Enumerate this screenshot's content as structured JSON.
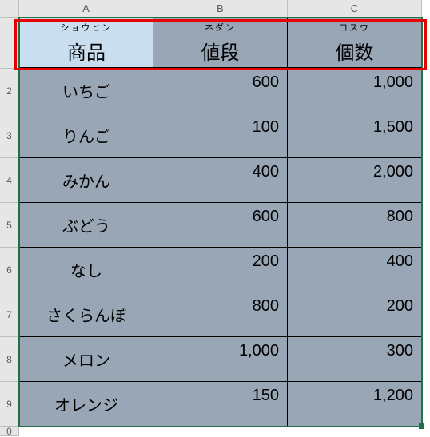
{
  "columns": {
    "A": "A",
    "B": "B",
    "C": "C"
  },
  "rownums": {
    "r2": "2",
    "r3": "3",
    "r4": "4",
    "r5": "5",
    "r6": "6",
    "r7": "7",
    "r8": "8",
    "r9": "9",
    "r10": "0"
  },
  "header": {
    "product": {
      "ruby": "ショウヒン",
      "label": "商品"
    },
    "price": {
      "ruby": "ネダン",
      "label": "値段"
    },
    "qty": {
      "ruby": "コスウ",
      "label": "個数"
    }
  },
  "rows": {
    "0": {
      "product": "いちご",
      "price": "600",
      "qty": "1,000"
    },
    "1": {
      "product": "りんご",
      "price": "100",
      "qty": "1,500"
    },
    "2": {
      "product": "みかん",
      "price": "400",
      "qty": "2,000"
    },
    "3": {
      "product": "ぶどう",
      "price": "600",
      "qty": "800"
    },
    "4": {
      "product": "なし",
      "price": "200",
      "qty": "400"
    },
    "5": {
      "product": "さくらんぼ",
      "price": "800",
      "qty": "200"
    },
    "6": {
      "product": "メロン",
      "price": "1,000",
      "qty": "300"
    },
    "7": {
      "product": "オレンジ",
      "price": "150",
      "qty": "1,200"
    }
  },
  "chart_data": {
    "type": "table",
    "title": "",
    "columns": [
      "商品",
      "値段",
      "個数"
    ],
    "column_ruby": [
      "ショウヒン",
      "ネダン",
      "コスウ"
    ],
    "records": [
      {
        "商品": "いちご",
        "値段": 600,
        "個数": 1000
      },
      {
        "商品": "りんご",
        "値段": 100,
        "個数": 1500
      },
      {
        "商品": "みかん",
        "値段": 400,
        "個数": 2000
      },
      {
        "商品": "ぶどう",
        "値段": 600,
        "個数": 800
      },
      {
        "商品": "なし",
        "値段": 200,
        "個数": 400
      },
      {
        "商品": "さくらんぼ",
        "値段": 800,
        "個数": 200
      },
      {
        "商品": "メロン",
        "値段": 1000,
        "個数": 300
      },
      {
        "商品": "オレンジ",
        "値段": 150,
        "個数": 1200
      }
    ]
  }
}
